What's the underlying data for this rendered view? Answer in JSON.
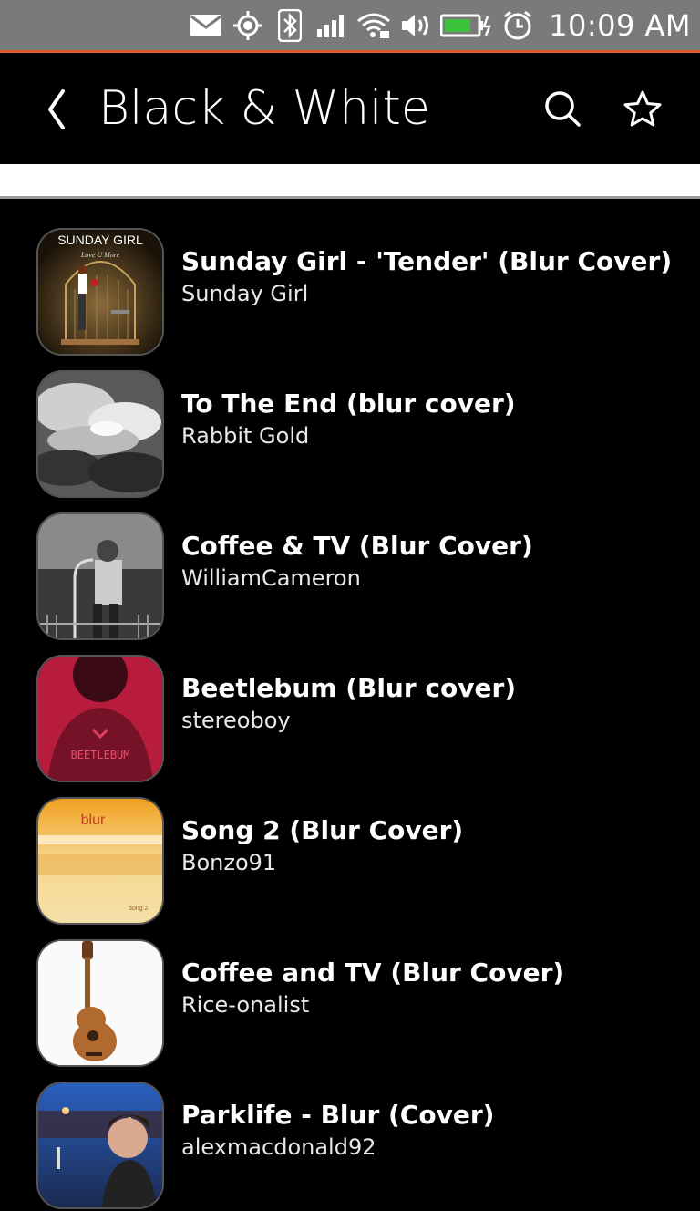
{
  "status_bar": {
    "time": "10:09 AM",
    "icons": [
      "mail-icon",
      "location-icon",
      "bluetooth-icon",
      "signal-icon",
      "wifi-icon",
      "volume-icon",
      "battery-icon",
      "alarm-icon"
    ],
    "accent_color": "#e05a2a"
  },
  "header": {
    "title": "Black & White",
    "back_icon": "chevron-left-icon",
    "search_icon": "search-icon",
    "favorite_icon": "star-icon"
  },
  "tracks": [
    {
      "title": "Sunday Girl -  'Tender' (Blur Cover)",
      "artist": "Sunday Girl",
      "art_text": "SUNDAY GIRL",
      "art_subtext": "Love U More"
    },
    {
      "title": "To The End (blur cover)",
      "artist": "Rabbit Gold"
    },
    {
      "title": "Coffee & TV (Blur Cover)",
      "artist": "WilliamCameron"
    },
    {
      "title": "Beetlebum (Blur cover)",
      "artist": "stereoboy",
      "art_text": "BEETLEBUM"
    },
    {
      "title": "Song 2 (Blur Cover)",
      "artist": "Bonzo91",
      "art_text": "blur",
      "art_subtext": "song 2"
    },
    {
      "title": "Coffee and TV (Blur Cover)",
      "artist": "Rice-onalist"
    },
    {
      "title": "Parklife - Blur (Cover)",
      "artist": "alexmacdonald92"
    }
  ]
}
